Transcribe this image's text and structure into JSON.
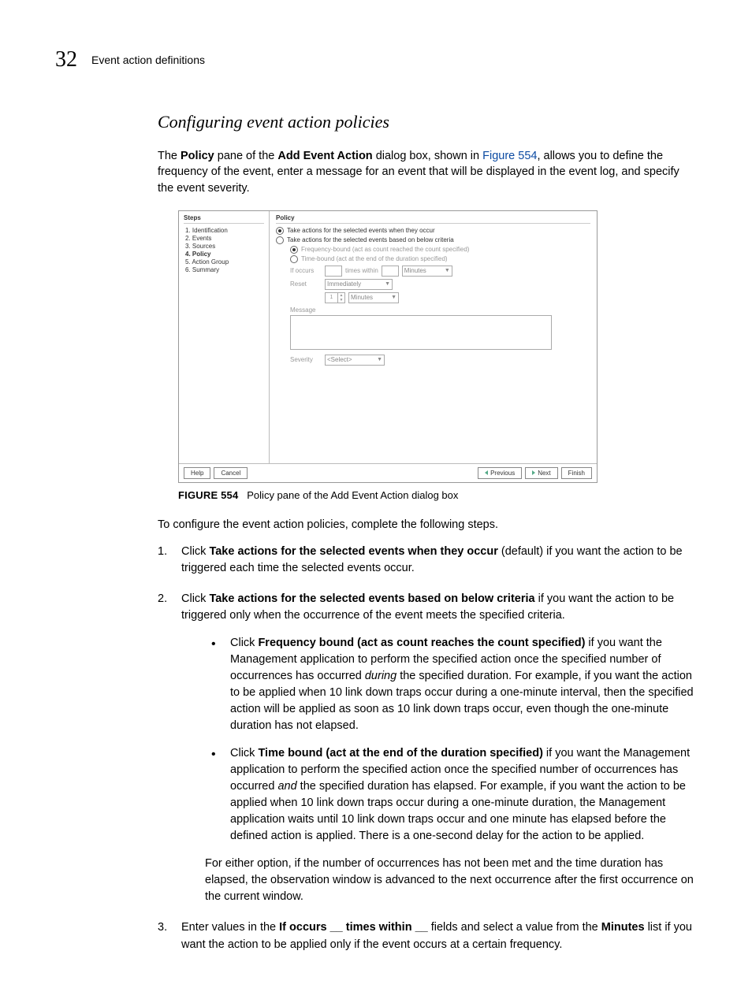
{
  "page": {
    "number": "32",
    "header_label": "Event action definitions"
  },
  "section_title": "Configuring event action policies",
  "intro": {
    "pre": "The ",
    "b1": "Policy",
    "mid1": " pane of the ",
    "b2": "Add Event Action",
    "mid2": " dialog box, shown in ",
    "link": "Figure 554",
    "post": ", allows you to define the frequency of the event, enter a message for an event that will be displayed in the event log, and specify the event severity."
  },
  "dialog": {
    "steps_title": "Steps",
    "steps": [
      "1. Identification",
      "2. Events",
      "3. Sources",
      "4. Policy",
      "5. Action Group",
      "6. Summary"
    ],
    "policy_title": "Policy",
    "radio1": "Take actions for the selected events when they occur",
    "radio2": "Take actions for the selected events based on below criteria",
    "subradio1": "Frequency-bound (act as count reached the count specified)",
    "subradio2": "Time-bound (act at the end of the duration specified)",
    "if_occurs_label": "If occurs",
    "times_within": "times within",
    "minutes": "Minutes",
    "reset_label": "Reset",
    "reset_value": "Immediately",
    "spinner_val": "1",
    "message_label": "Message",
    "severity_label": "Severity",
    "severity_value": "<Select>",
    "buttons": {
      "help": "Help",
      "cancel": "Cancel",
      "previous": "Previous",
      "next": "Next",
      "finish": "Finish"
    }
  },
  "figure_caption": {
    "label": "FIGURE 554",
    "text": "Policy pane of the Add Event Action dialog box"
  },
  "lead_text": "To configure the event action policies, complete the following steps.",
  "step1": {
    "pre": "Click ",
    "bold": "Take actions for the selected events when they occur",
    "post": " (default) if you want the action to be triggered each time the selected events occur."
  },
  "step2": {
    "pre": "Click ",
    "bold": "Take actions for the selected events based on below criteria",
    "post": " if you want the action to be triggered only when the occurrence of the event meets the specified criteria."
  },
  "bullet1": {
    "pre": "Click ",
    "bold": "Frequency bound (act as count reaches the count specified)",
    "mid": " if you want the Management application to perform the specified action once the specified number of occurrences has occurred ",
    "during": "during",
    "post": " the specified duration. For example, if you want the action to be applied when 10 link down traps occur during a one-minute interval, then the specified action will be applied as soon as 10 link down traps occur, even though the one-minute duration has not elapsed."
  },
  "bullet2": {
    "pre": "Click ",
    "bold": "Time bound (act at the end of the duration specified)",
    "mid": " if you want the Management application to perform the specified action once the specified number of occurrences has occurred ",
    "and": "and",
    "post": " the specified duration has elapsed. For example, if you want the action to be applied when 10 link down traps occur during a one-minute duration, the Management application waits until 10 link down traps occur and one minute has elapsed before the defined action is applied. There is a one-second delay for the action to be applied."
  },
  "step2_note": "For either option, if the number of occurrences has not been met and the time duration has elapsed, the observation window is advanced to the next occurrence after the first occurrence on the current window.",
  "step3": {
    "pre": "Enter values in the ",
    "bold1": "If occurs __ times within __",
    "mid": " fields and select a value from the ",
    "bold2": "Minutes",
    "post": " list if you want the action to be applied only if the event occurs at a certain frequency."
  }
}
